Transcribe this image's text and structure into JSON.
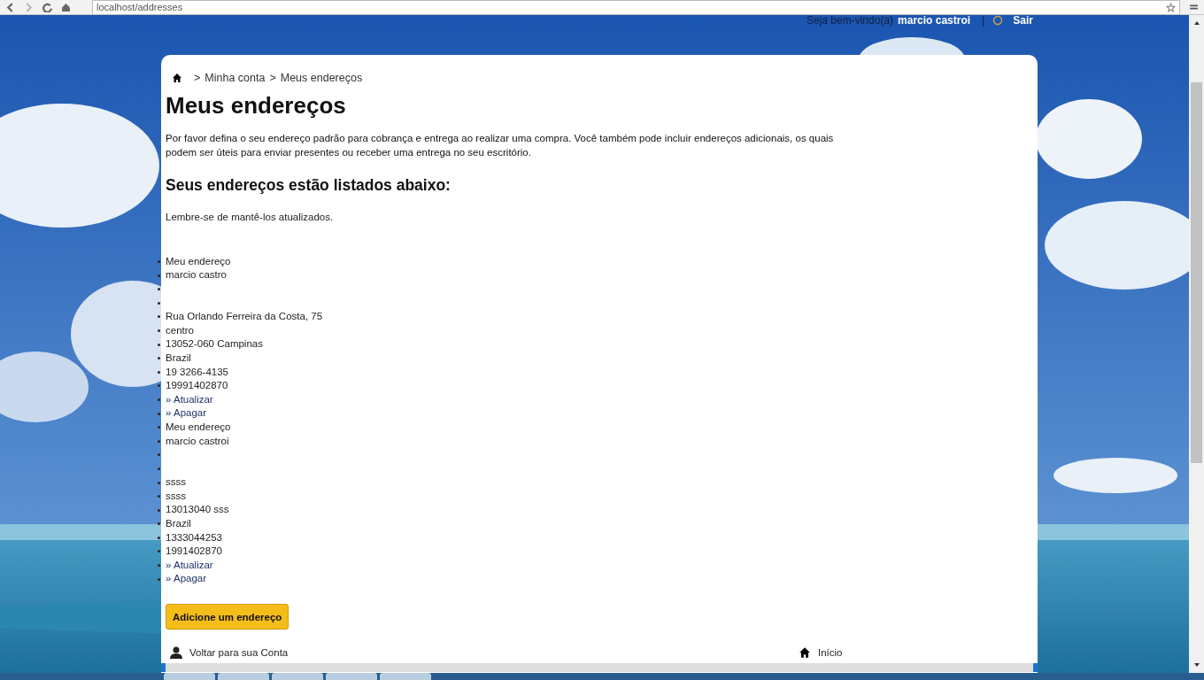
{
  "browser": {
    "url": "localhost/addresses"
  },
  "header": {
    "greeting": "Seja bem-vindo(a)",
    "user": "marcio castroi",
    "separator": "|",
    "logout": "Sair"
  },
  "breadcrumb": {
    "separator": ">",
    "items": [
      {
        "label": "Minha conta"
      },
      {
        "label": "Meus endereços"
      }
    ]
  },
  "title": "Meus endereços",
  "intro": "Por favor defina o seu endereço padrão para cobrança e entrega ao realizar uma compra. Você também pode incluir endereços adicionais, os quais podem ser úteis para enviar presentes ou receber uma entrega no seu escritório.",
  "subtitle": "Seus endereços estão listados abaixo:",
  "reminder": "Lembre-se de mantê-los atualizados.",
  "addresses": [
    {
      "lines": [
        {
          "kind": "text",
          "text": "Meu endereço"
        },
        {
          "kind": "text",
          "text": "marcio castro"
        },
        {
          "kind": "blank"
        },
        {
          "kind": "blank"
        },
        {
          "kind": "text",
          "text": "Rua Orlando Ferreira da Costa, 75"
        },
        {
          "kind": "text",
          "text": "centro"
        },
        {
          "kind": "text",
          "text": "13052-060 Campinas"
        },
        {
          "kind": "text",
          "text": "Brazil"
        },
        {
          "kind": "text",
          "text": "19 3266-4135"
        },
        {
          "kind": "text",
          "text": "19991402870"
        },
        {
          "kind": "link",
          "text": "» Atualizar"
        },
        {
          "kind": "link",
          "text": "» Apagar"
        }
      ]
    },
    {
      "lines": [
        {
          "kind": "text",
          "text": "Meu endereço"
        },
        {
          "kind": "text",
          "text": "marcio castroi"
        },
        {
          "kind": "blank"
        },
        {
          "kind": "blank"
        },
        {
          "kind": "text",
          "text": "ssss"
        },
        {
          "kind": "text",
          "text": "ssss"
        },
        {
          "kind": "text",
          "text": "13013040 sss"
        },
        {
          "kind": "text",
          "text": "Brazil"
        },
        {
          "kind": "text",
          "text": "1333044253"
        },
        {
          "kind": "text",
          "text": "1991402870"
        },
        {
          "kind": "link",
          "text": "» Atualizar"
        },
        {
          "kind": "link",
          "text": "» Apagar"
        }
      ]
    }
  ],
  "add_button": "Adicione um endereço",
  "footer_links": [
    {
      "kind": "person",
      "label": "Voltar para sua Conta"
    },
    {
      "kind": "home",
      "label": "Início"
    }
  ]
}
